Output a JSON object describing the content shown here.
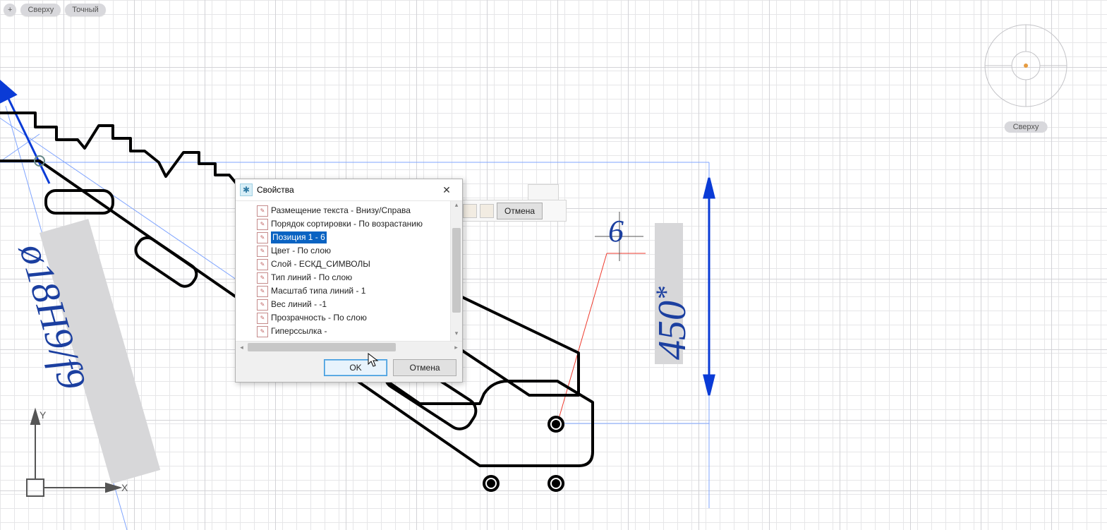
{
  "pills": {
    "plus": "+",
    "top": "Сверху",
    "exact": "Точный"
  },
  "navcube": {
    "label": "Сверху"
  },
  "dimensions": {
    "phi": "ø18H9/f9",
    "len": "450",
    "star": "*"
  },
  "leader_text": "6",
  "ucs": {
    "x": "X",
    "y": "Y"
  },
  "ribbon": {
    "cancel": "Отмена"
  },
  "dialog": {
    "title": "Свойства",
    "items": [
      "Размещение текста - Внизу/Справа",
      "Порядок сортировки - По возрастанию",
      "Позиция 1 - 6",
      "Цвет - По слою",
      "Слой - ЕСКД_СИМВОЛЫ",
      "Тип линий - По слою",
      "Масштаб типа линий - 1",
      "Вес линий - -1",
      "Прозрачность - По слою",
      "Гиперссылка -"
    ],
    "selected_index": 2,
    "ok": "OK",
    "cancel": "Отмена"
  }
}
